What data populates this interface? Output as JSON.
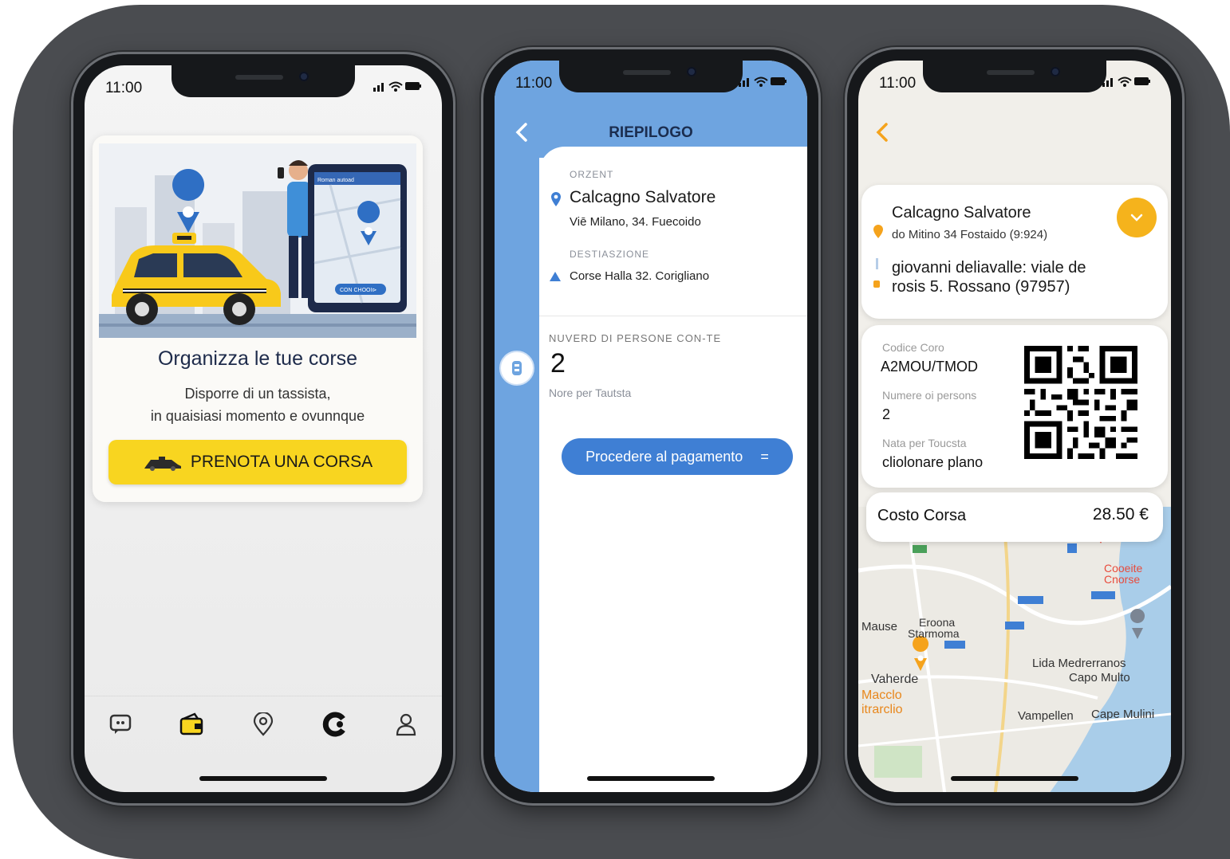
{
  "status": {
    "time": "11:00"
  },
  "screen1": {
    "illustration": {
      "phone_header": "Roman autoad",
      "phone_button": "CON CHOOI⊳"
    },
    "title": "Organizza le tue corse",
    "subtitle_line1": "Disporre di un tassista,",
    "subtitle_line2": "in quaisiasi momento e ovunnque",
    "cta_label": "PRENOTA UNA CORSA",
    "tabs": [
      "chat-icon",
      "wallet-icon",
      "location-pin-icon",
      "brand-c-icon",
      "profile-icon"
    ]
  },
  "screen2": {
    "header_title": "RIEPILOGO",
    "origin_label": "ORZENT",
    "origin_name": "Calcagno Salvatore",
    "origin_address": "Viē Milano, 34. Fuecoido",
    "destination_label": "DESTIASZIONE",
    "destination_address": "Corse Halla 32. Corigliano",
    "persons_label": "NUVERD DI PERSONE CON-TE",
    "persons_value": "2",
    "notes_label": "Nore per Tautsta",
    "pay_button": "Procedere al pagamento",
    "pay_button_icon": "="
  },
  "screen3": {
    "passenger_name": "Calcagno Salvatore",
    "pickup": "do Mitino 34 Fostaido (9:924)",
    "destination_line1": "giovanni deliavalle: viale de",
    "destination_line2": "rosis 5. Rossano (97957)",
    "code_label": "Codice Coro",
    "code_value": "A2MOU/TMOD",
    "persons_label": "Numere oi persons",
    "persons_value": "2",
    "note_label": "Nata per Toucsta",
    "note_value": "cliolonare plano",
    "cost_label": "Costo Corsa",
    "cost_value": "28.50 €",
    "map_labels": {
      "coopite": "Cooeite",
      "cnorse": "Cnorse",
      "mause": "Mause",
      "eroona": "Eroona",
      "starmoma": "Starmoma",
      "lida": "Lida Medrerranos",
      "capo_multo": "Capo Multo",
      "vaherde": "Vaherde",
      "macclo": "Macclo",
      "itrarclio": "itrarclio",
      "vampellen": "Vampellen",
      "cape_mulini": "Cape Mulini"
    }
  },
  "colors": {
    "accent_yellow": "#f8d520",
    "blue": "#3f7fd4",
    "orange": "#f5b31c",
    "navy": "#1d2a4a"
  }
}
